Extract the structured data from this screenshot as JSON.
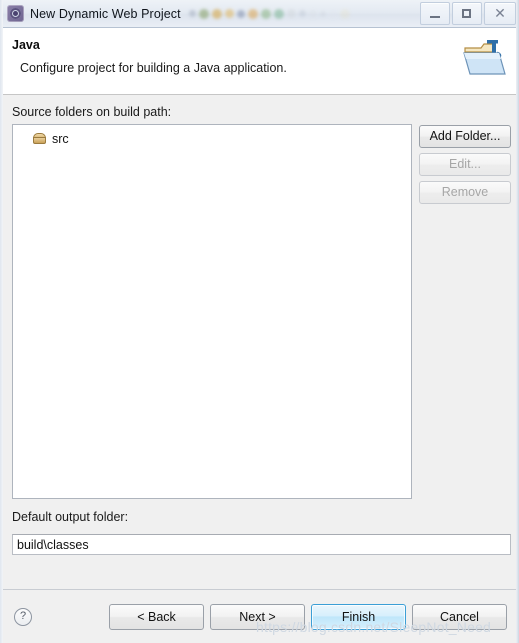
{
  "titlebar": {
    "app_icon": "wizard-gear-icon",
    "title": "New Dynamic Web Project",
    "ghost_icons": [
      {
        "color": "#b9c2d0",
        "size": 7
      },
      {
        "color": "#9fb48c",
        "size": 10
      },
      {
        "color": "#d7b46a",
        "size": 10
      },
      {
        "color": "#e0c07a",
        "size": 9
      },
      {
        "color": "#8d9ab4",
        "size": 8
      },
      {
        "color": "#dba85a",
        "size": 10
      },
      {
        "color": "#86b27e",
        "size": 10
      },
      {
        "color": "#6fae87",
        "size": 10
      },
      {
        "color": "#cfd4d8",
        "size": 9
      },
      {
        "color": "#b7c0cc",
        "size": 7
      },
      {
        "color": "#d8dde4",
        "size": 8
      },
      {
        "color": "#c3cad4",
        "size": 6
      },
      {
        "color": "#dde2e8",
        "size": 8
      },
      {
        "color": "#ead9a8",
        "size": 10
      }
    ],
    "minimize_label": "Minimize",
    "maximize_label": "Maximize",
    "close_label": "✕"
  },
  "header": {
    "title": "Java",
    "description": "Configure project for building a Java application.",
    "icon": "java-folder-icon"
  },
  "main": {
    "source_folders_label": "Source folders on build path:",
    "tree_items": [
      {
        "label": "src",
        "icon": "package-folder-icon"
      }
    ],
    "buttons": {
      "add_folder": "Add Folder...",
      "edit": "Edit...",
      "remove": "Remove"
    },
    "output_label": "Default output folder:",
    "output_value": "build\\classes",
    "output_placeholder": "Default output folder"
  },
  "footer": {
    "help_glyph": "?",
    "back": "< Back",
    "next": "Next >",
    "finish": "Finish",
    "cancel": "Cancel"
  },
  "watermark": {
    "text": "https://blog.csdn.net/SleepNot_Need"
  },
  "colors": {
    "accent": "#3c9fd6",
    "dialog_bg": "#f0f0f0",
    "header_bg": "#ffffff",
    "field_bg": "#ffffff"
  }
}
